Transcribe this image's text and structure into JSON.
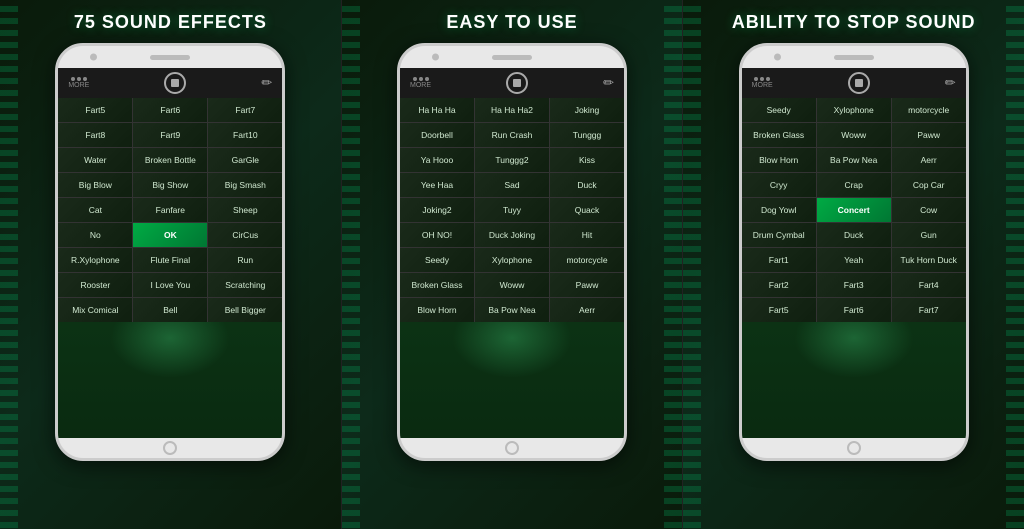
{
  "sections": [
    {
      "id": "left",
      "title": "75 SOUND EFFECTS",
      "cells": [
        "Fart5",
        "Fart6",
        "Fart7",
        "Fart8",
        "Fart9",
        "Fart10",
        "Water",
        "Broken Bottle",
        "GarGle",
        "Big Blow",
        "Big Show",
        "Big Smash",
        "Cat",
        "Fanfare",
        "Sheep",
        "No",
        "OK",
        "CirCus",
        "R.Xylophone",
        "Flute Final",
        "Run",
        "Rooster",
        "I Love You",
        "Scratching",
        "Mix Comical",
        "Bell",
        "Bell Bigger"
      ],
      "activeIndex": 16
    },
    {
      "id": "mid",
      "title": "EASY TO USE",
      "cells": [
        "Ha Ha Ha",
        "Ha Ha Ha2",
        "Joking",
        "Doorbell",
        "Run Crash",
        "Tunggg",
        "Ya Hooo",
        "Tunggg2",
        "Kiss",
        "Yee Haa",
        "Sad",
        "Duck",
        "Joking2",
        "Tuyy",
        "Quack",
        "OH NO!",
        "Duck Joking",
        "Hit",
        "Seedy",
        "Xylophone",
        "motorcycle",
        "Broken Glass",
        "Woww",
        "Paww",
        "Blow Horn",
        "Ba Pow Nea",
        "Aerr"
      ],
      "activeIndex": -1
    },
    {
      "id": "right",
      "title": "ABILITY TO STOP SOUND",
      "cells": [
        "Seedy",
        "Xylophone",
        "motorcycle",
        "Broken Glass",
        "Woww",
        "Paww",
        "Blow Horn",
        "Ba Pow Nea",
        "Aerr",
        "Cryy",
        "Crap",
        "Cop Car",
        "Dog Yowl",
        "Concert",
        "Cow",
        "Drum Cymbal",
        "Duck",
        "Gun",
        "Fart1",
        "Yeah",
        "Tuk Horn Duck",
        "Fart2",
        "Fart3",
        "Fart4",
        "Fart5",
        "Fart6",
        "Fart7"
      ],
      "activeIndex": 13
    }
  ]
}
